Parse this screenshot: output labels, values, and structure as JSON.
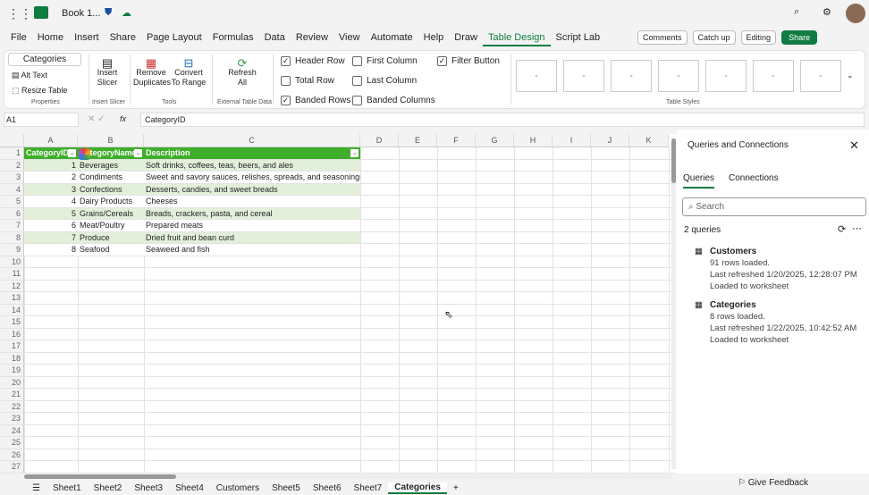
{
  "titlebar": {
    "doc_title": "Book 1..."
  },
  "menu": [
    "File",
    "Home",
    "Insert",
    "Share",
    "Page Layout",
    "Formulas",
    "Data",
    "Review",
    "View",
    "Automate",
    "Help",
    "Draw",
    "Table Design",
    "Script Lab"
  ],
  "menu_active": "Table Design",
  "top_right": {
    "comments": "Comments",
    "catch_up": "Catch up",
    "editing": "Editing",
    "share": "Share"
  },
  "ribbon": {
    "table_name": "Categories",
    "alt_text": "Alt Text",
    "resize_table": "Resize Table",
    "properties": "Properties",
    "insert_slicer": "Insert Slicer",
    "insert_slicer_group": "Insert Slicer",
    "remove_duplicates": "Remove Duplicates",
    "convert_to_range": "Convert To Range",
    "tools": "Tools",
    "refresh_all": "Refresh All",
    "external_table_data": "External Table Data",
    "header_row": "Header Row",
    "total_row": "Total Row",
    "banded_rows": "Banded Rows",
    "first_column": "First Column",
    "last_column": "Last Column",
    "banded_columns": "Banded Columns",
    "filter_button": "Filter Button",
    "table_styles": "Table Styles",
    "style_placeholder": "-"
  },
  "formula_bar": {
    "name_box": "A1",
    "fx": "fx",
    "value": "CategoryID"
  },
  "columns": [
    "A",
    "B",
    "C",
    "D",
    "E",
    "F",
    "G",
    "H",
    "I",
    "J",
    "K"
  ],
  "table": {
    "headers": [
      "CategoryID",
      "CategoryName",
      "Description"
    ],
    "rows": [
      [
        "1",
        "Beverages",
        "Soft drinks, coffees, teas, beers, and ales"
      ],
      [
        "2",
        "Condiments",
        "Sweet and savory sauces, relishes, spreads, and seasonings"
      ],
      [
        "3",
        "Confections",
        "Desserts, candies, and sweet breads"
      ],
      [
        "4",
        "Dairy Products",
        "Cheeses"
      ],
      [
        "5",
        "Grains/Cereals",
        "Breads, crackers, pasta, and cereal"
      ],
      [
        "6",
        "Meat/Poultry",
        "Prepared meats"
      ],
      [
        "7",
        "Produce",
        "Dried fruit and bean curd"
      ],
      [
        "8",
        "Seafood",
        "Seaweed and fish"
      ]
    ]
  },
  "pane": {
    "title": "Queries and Connections",
    "tabs": [
      "Queries",
      "Connections"
    ],
    "search_placeholder": "Search",
    "count": "2 queries",
    "queries": [
      {
        "name": "Customers",
        "rows": "91 rows loaded.",
        "refreshed": "Last refreshed 1/20/2025, 12:28:07 PM",
        "loaded": "Loaded to worksheet"
      },
      {
        "name": "Categories",
        "rows": "8 rows loaded.",
        "refreshed": "Last refreshed 1/22/2025, 10:42:52 AM",
        "loaded": "Loaded to worksheet"
      }
    ],
    "feedback": "Give Feedback"
  },
  "sheets": [
    "Sheet1",
    "Sheet2",
    "Sheet3",
    "Sheet4",
    "Customers",
    "Sheet5",
    "Sheet6",
    "Sheet7",
    "Categories"
  ],
  "active_sheet": "Categories",
  "colors": {
    "accent": "#107c41",
    "header_green": "#3fae2a",
    "band": "#e2efda"
  }
}
